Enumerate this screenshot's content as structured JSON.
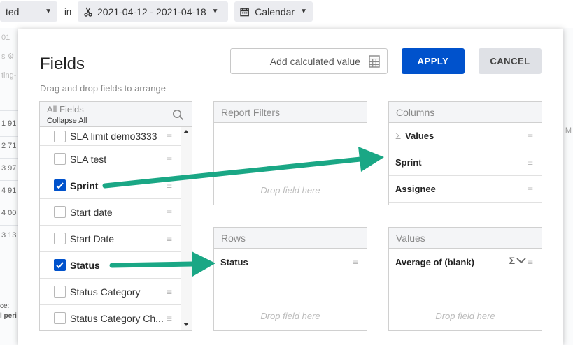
{
  "topbar": {
    "status_partial": "ted",
    "in_label": "in",
    "date_range": "2021-04-12 - 2021-04-18",
    "calendar_label": "Calendar"
  },
  "background": {
    "rows": [
      "1 91",
      "2 71",
      "3 97",
      "4 91",
      "4 00",
      "3 13"
    ],
    "snippet_top": "01",
    "snippet_ting": "ting-",
    "right_letter": "M",
    "footer_line1": "ce:",
    "footer_line2": "l peri"
  },
  "modal": {
    "title": "Fields",
    "subtitle": "Drag and drop fields to arrange",
    "add_calculated_label": "Add calculated value",
    "apply_label": "APPLY",
    "cancel_label": "CANCEL"
  },
  "all_fields": {
    "title": "All Fields",
    "collapse_label": "Collapse All",
    "items": [
      {
        "label": "SLA limit demo3333",
        "checked": false
      },
      {
        "label": "SLA test",
        "checked": false
      },
      {
        "label": "Sprint",
        "checked": true
      },
      {
        "label": "Start date",
        "checked": false
      },
      {
        "label": "Start Date",
        "checked": false
      },
      {
        "label": "Status",
        "checked": true
      },
      {
        "label": "Status Category",
        "checked": false
      },
      {
        "label": "Status Category Ch...",
        "checked": false
      }
    ]
  },
  "report_filters": {
    "title": "Report Filters",
    "drop_hint": "Drop field here"
  },
  "columns": {
    "title": "Columns",
    "items": [
      "Values",
      "Sprint",
      "Assignee"
    ]
  },
  "rows": {
    "title": "Rows",
    "items": [
      "Status"
    ],
    "drop_hint": "Drop field here"
  },
  "values": {
    "title": "Values",
    "items": [
      "Average of (blank)"
    ],
    "drop_hint": "Drop field here"
  },
  "colors": {
    "primary": "#0052cc",
    "arrow": "#1aa785",
    "panel_header": "#f4f5f7"
  }
}
